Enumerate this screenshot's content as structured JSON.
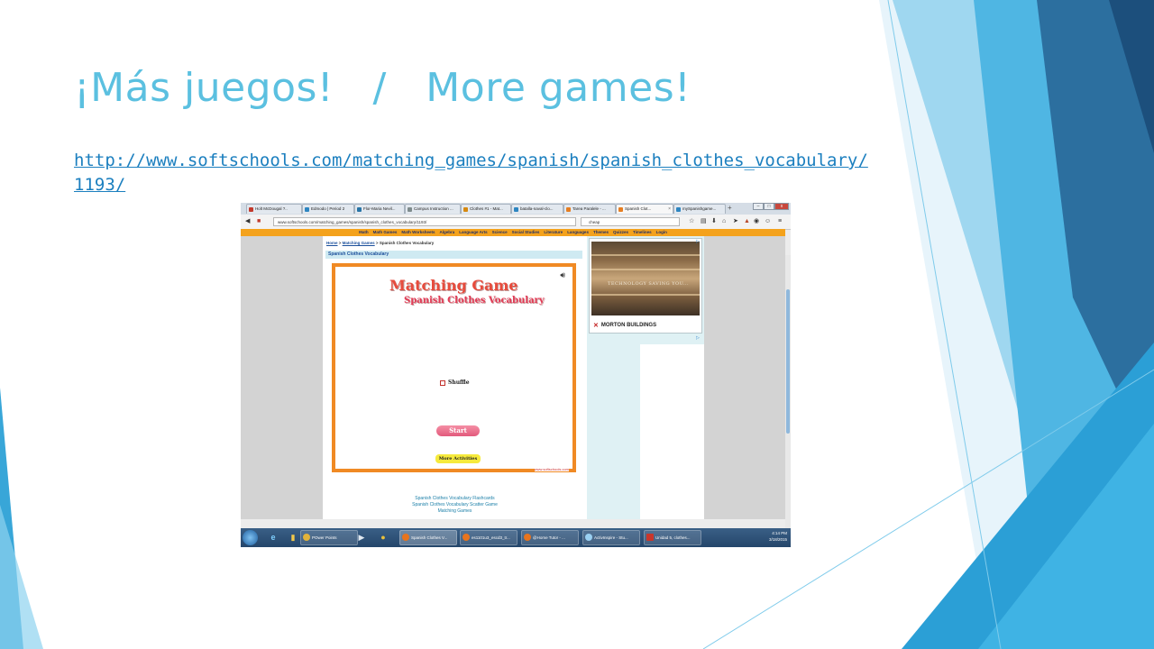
{
  "slide": {
    "title": "¡Más juegos!   /   More games!",
    "link": "http://www.softschools.com/matching_games/spanish/spanish_clothes_vocabulary/1193/"
  },
  "browser": {
    "tabs": [
      {
        "label": "Holt McDougal ?..",
        "color": "#c3392b"
      },
      {
        "label": "Edmodo | Period 2",
        "color": "#2e86c1"
      },
      {
        "label": "Flor-Maria Nevil...",
        "color": "#2874a6"
      },
      {
        "label": "Campus Instruction ...",
        "color": "#7f8c8d"
      },
      {
        "label": "Clothes #1 - Mat...",
        "color": "#d68910"
      },
      {
        "label": "batalla-naval-clo...",
        "color": "#2e86c1"
      },
      {
        "label": "Tarea Paralele - ...",
        "color": "#e67e22"
      },
      {
        "label": "Spanish Clot...",
        "color": "#e67e22",
        "active": true
      },
      {
        "label": "mySpanishgame...",
        "color": "#2e86c1"
      }
    ],
    "url": "www.softschools.com/matching_games/spanish/spanish_clothes_vocabulary/1193/",
    "search": "cheap",
    "win_buttons": [
      "–",
      "□",
      "x"
    ]
  },
  "site": {
    "nav": [
      "Math",
      "Math Games",
      "Math Worksheets",
      "Algebra",
      "Language Arts",
      "Science",
      "Social Studies",
      "Literature",
      "Languages",
      "Themes",
      "Quizzes",
      "Timelines",
      "Login"
    ],
    "breadcrumb": {
      "home": "Home",
      "sep1": " > ",
      "matching": "Matching Games",
      "sep2": " > ",
      "current": "Spanish Clothes Vocabulary"
    },
    "section_title": "Spanish Clothes Vocabulary",
    "game": {
      "title": "Matching Game",
      "subtitle": "Spanish Clothes Vocabulary",
      "shuffle_label": "Shuffle",
      "start_label": "Start",
      "more_label": "More Activities",
      "credit": "www.softschools.com"
    },
    "links": [
      "Spanish Clothes Vocabulary Flashcards",
      "Spanish Clothes Vocabulary Scatter Game",
      "Matching Games"
    ],
    "ad": {
      "caption": "TECHNOLOGY SAVING YOU...",
      "brand": "MORTON BUILDINGS"
    }
  },
  "taskbar": {
    "items": [
      {
        "label": "POwer Points",
        "color": "#e2b33a"
      },
      {
        "label": "Spanish Clothes V...",
        "color": "#e8741d"
      },
      {
        "label": "es1101u3_escd3_tr...",
        "color": "#e8741d"
      },
      {
        "label": "@Home Tutor - ...",
        "color": "#e8741d"
      },
      {
        "label": "ActivInspire - Stu...",
        "color": "#9ad0f2"
      },
      {
        "label": "Unidad 5, clothes...",
        "color": "#c9362b"
      }
    ],
    "time": "4:14 PM",
    "date": "3/18/2015"
  }
}
